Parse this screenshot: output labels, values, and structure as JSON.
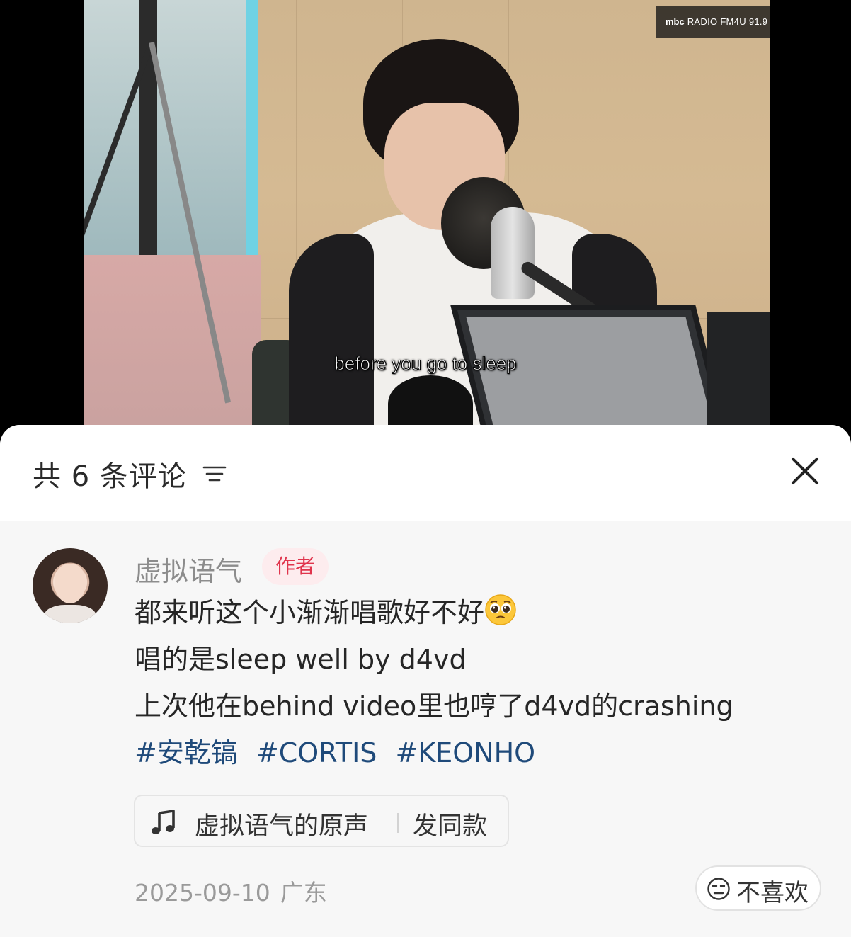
{
  "video": {
    "watermark_brand": "mbc",
    "watermark_text": "RADIO FM4U 91.9",
    "subtitle": "before you go to sleep"
  },
  "comments_panel": {
    "title": "共 6 条评论",
    "sort_icon": "sort-lines-icon",
    "close_icon": "close-x-icon"
  },
  "comment": {
    "author": "虚拟语气",
    "author_badge": "作者",
    "lines": [
      "都来听这个小渐渐唱歌好不好",
      "唱的是sleep well by d4vd",
      "上次他在behind video里也哼了d4vd的crashing"
    ],
    "emoji": "pleading-face-emoji",
    "tags": [
      "#安乾镐",
      "#CORTIS",
      "#KEONHO"
    ],
    "sound": {
      "label": "虚拟语气的原声",
      "action": "发同款",
      "icon": "music-note-icon"
    },
    "date": "2025-09-10",
    "location": "广东",
    "dislike_label": "不喜欢",
    "dislike_icon": "unamused-face-icon"
  },
  "colors": {
    "badge_bg": "#fdecee",
    "badge_text": "#e0344c",
    "tag": "#1f4a7a",
    "sheet_bg": "#f7f7f7"
  }
}
